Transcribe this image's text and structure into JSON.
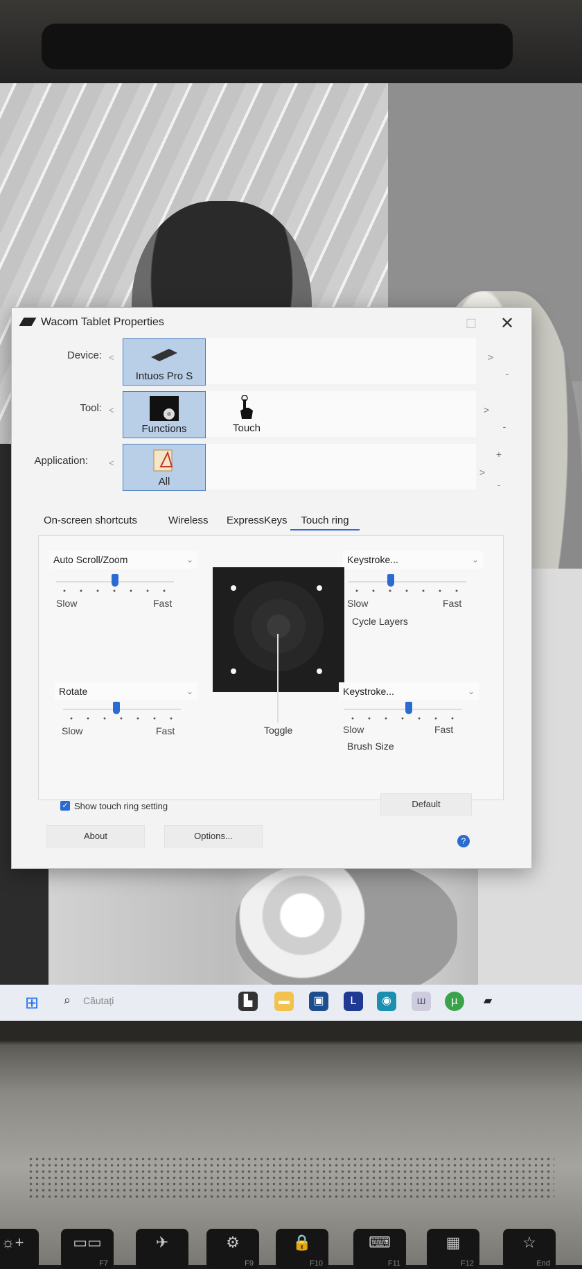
{
  "window": {
    "title": "Wacom Tablet Properties"
  },
  "device": {
    "label": "Device:",
    "items": [
      {
        "name": "Intuos Pro S"
      }
    ]
  },
  "tool": {
    "label": "Tool:",
    "items": [
      {
        "name": "Functions"
      },
      {
        "name": "Touch"
      }
    ]
  },
  "application": {
    "label": "Application:",
    "items": [
      {
        "name": "All"
      }
    ],
    "add": "+",
    "remove": "-"
  },
  "nav": {
    "prev": "<",
    "next": ">",
    "minus": "-"
  },
  "tabs": [
    {
      "label": "On-screen shortcuts"
    },
    {
      "label": "Wireless"
    },
    {
      "label": "ExpressKeys"
    },
    {
      "label": "Touch ring",
      "active": true
    }
  ],
  "touch_ring": {
    "top_left": {
      "function": "Auto Scroll/Zoom",
      "speed": 0.5,
      "slow": "Slow",
      "fast": "Fast"
    },
    "top_right": {
      "function": "Keystroke...",
      "speed": 0.35,
      "slow": "Slow",
      "fast": "Fast",
      "action": "Cycle Layers"
    },
    "bottom_left": {
      "function": "Rotate",
      "speed": 0.45,
      "slow": "Slow",
      "fast": "Fast"
    },
    "bottom_right": {
      "function": "Keystroke...",
      "speed": 0.55,
      "slow": "Slow",
      "fast": "Fast",
      "action": "Brush Size"
    },
    "center": {
      "label": "Toggle"
    }
  },
  "show_setting": {
    "label": "Show touch ring setting",
    "checked": true
  },
  "buttons": {
    "default": "Default",
    "about": "About",
    "options": "Options...",
    "help": "?"
  },
  "taskbar": {
    "search_placeholder": "Căutați"
  },
  "keyboard": [
    {
      "icon": "gear-plus-icon",
      "glyph": "☼+",
      "fn": ""
    },
    {
      "icon": "display-icon",
      "glyph": "▭▭",
      "fn": "F7"
    },
    {
      "icon": "airplane-icon",
      "glyph": "✈",
      "fn": ""
    },
    {
      "icon": "settings-icon",
      "glyph": "⚙",
      "fn": "F9"
    },
    {
      "icon": "lock-icon",
      "glyph": "🔒",
      "fn": "F10"
    },
    {
      "icon": "keyboard-icon",
      "glyph": "⌨",
      "fn": "F11"
    },
    {
      "icon": "calculator-icon",
      "glyph": "▦",
      "fn": "F12"
    },
    {
      "icon": "star-icon",
      "glyph": "☆",
      "fn": "End"
    }
  ],
  "colors": {
    "accent": "#2a6bd1",
    "selected_bg": "#b9cfe8"
  }
}
